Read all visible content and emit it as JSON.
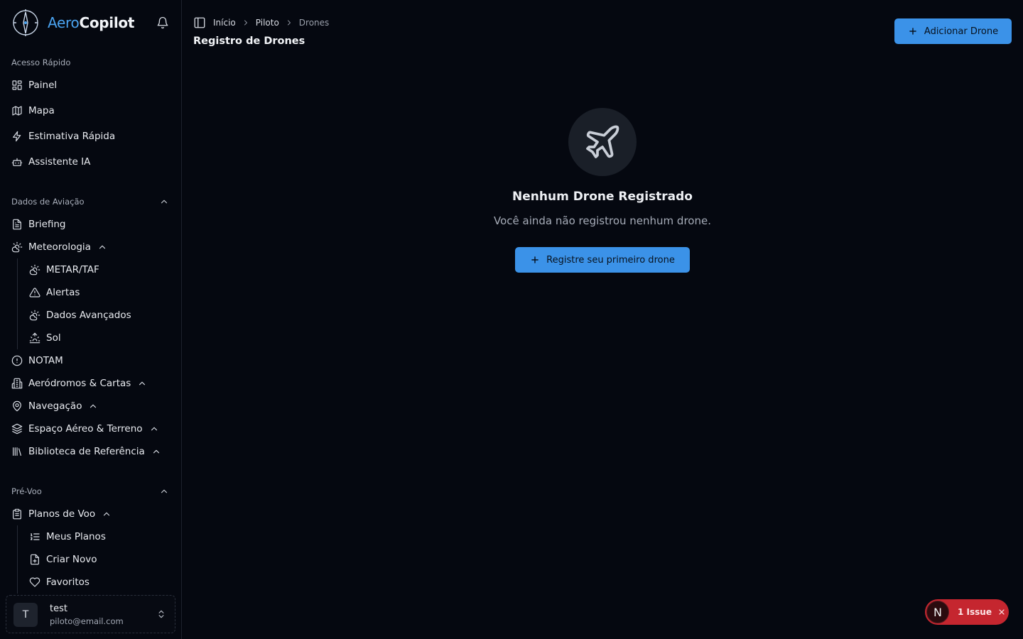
{
  "brand": {
    "name_part1": "Aero",
    "name_part2": "Copilot"
  },
  "sidebar": {
    "quick_access": {
      "label": "Acesso Rápido",
      "items": [
        {
          "label": "Painel",
          "icon": "dashboard-icon"
        },
        {
          "label": "Mapa",
          "icon": "map-icon"
        },
        {
          "label": "Estimativa Rápida",
          "icon": "lightning-icon"
        },
        {
          "label": "Assistente IA",
          "icon": "bot-icon"
        }
      ]
    },
    "aviation_data": {
      "label": "Dados de Aviação",
      "items": [
        {
          "label": "Briefing",
          "icon": "file-text-icon"
        },
        {
          "label": "Meteorologia",
          "icon": "cloud-sun-icon"
        },
        {
          "label": "NOTAM",
          "icon": "alert-circle-icon"
        },
        {
          "label": "Aeródromos & Cartas",
          "icon": "building-icon"
        },
        {
          "label": "Navegação",
          "icon": "map-pin-icon"
        },
        {
          "label": "Espaço Aéreo & Terreno",
          "icon": "layers-icon"
        },
        {
          "label": "Biblioteca de Referência",
          "icon": "library-icon"
        }
      ],
      "meteorology_sub": [
        {
          "label": "METAR/TAF",
          "icon": "cloud-sun-icon"
        },
        {
          "label": "Alertas",
          "icon": "warning-triangle-icon"
        },
        {
          "label": "Dados Avançados",
          "icon": "cloud-sun-icon"
        },
        {
          "label": "Sol",
          "icon": "sunrise-icon"
        }
      ]
    },
    "preflight": {
      "label": "Pré-Voo",
      "items": [
        {
          "label": "Planos de Voo",
          "icon": "clipboard-icon"
        }
      ],
      "flight_plans_sub": [
        {
          "label": "Meus Planos",
          "icon": "list-ordered-icon"
        },
        {
          "label": "Criar Novo",
          "icon": "file-plus-icon"
        },
        {
          "label": "Favoritos",
          "icon": "heart-icon"
        }
      ]
    },
    "user": {
      "initial": "T",
      "name": "test",
      "email": "piloto@email.com"
    }
  },
  "header": {
    "breadcrumb": [
      "Início",
      "Piloto",
      "Drones"
    ],
    "title": "Registro de Drones",
    "add_button": "Adicionar Drone"
  },
  "empty_state": {
    "title": "Nenhum Drone Registrado",
    "subtitle": "Você ainda não registrou nenhum drone.",
    "button": "Registre seu primeiro drone"
  },
  "issue_badge": {
    "initial": "N",
    "text": "1 Issue"
  },
  "colors": {
    "background": "#050810",
    "accent": "#3b92e8",
    "issue": "#c5262f"
  }
}
